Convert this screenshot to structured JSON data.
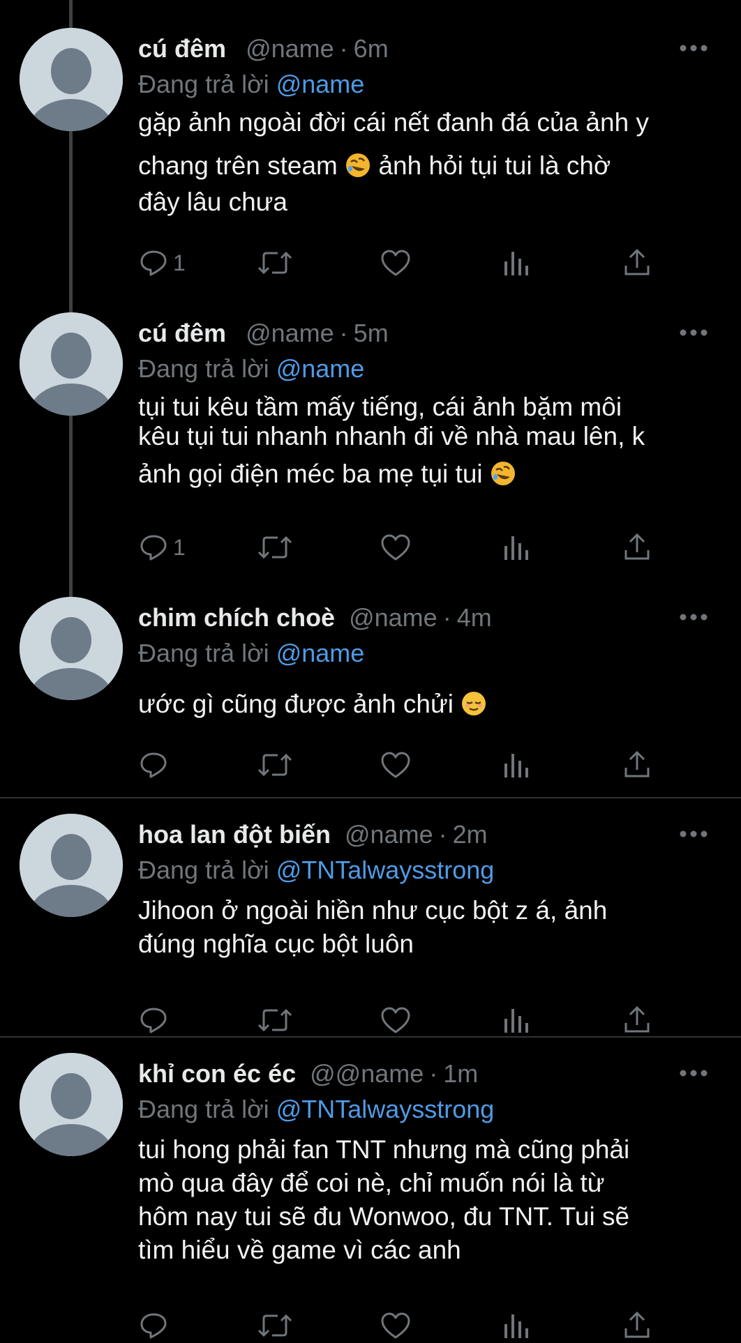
{
  "tweets": [
    {
      "name": "cú đêm",
      "handle": "@name",
      "time": "6m",
      "reply_label": "Đang trả lời",
      "reply_to": "@name",
      "lines": [
        "gặp ảnh ngoài đời cái nết đanh đá của ảnh y",
        "chang trên steam",
        "ảnh hỏi tụi tui là chờ",
        "đây lâu chưa"
      ],
      "reply_count": "1"
    },
    {
      "name": "cú đêm",
      "handle": "@name",
      "time": "5m",
      "reply_label": "Đang trả lời",
      "reply_to": "@name",
      "lines": [
        "tụi tui kêu tầm mấy tiếng, cái ảnh bặm môi",
        "kêu tụi tui nhanh nhanh đi về nhà mau lên, k",
        "ảnh gọi điện méc ba mẹ tụi tui"
      ],
      "reply_count": "1"
    },
    {
      "name": "chim chích choè",
      "handle": "@name",
      "time": "4m",
      "reply_label": "Đang trả lời",
      "reply_to": "@name",
      "lines": [
        "ước gì cũng được ảnh chửi"
      ],
      "reply_count": ""
    },
    {
      "name": "hoa lan đột biến",
      "handle": "@name",
      "time": "2m",
      "reply_label": "Đang trả lời",
      "reply_to": "@TNTalwaysstrong",
      "lines": [
        "Jihoon ở ngoài hiền như cục bột z á, ảnh",
        "đúng nghĩa cục bột luôn"
      ],
      "reply_count": ""
    },
    {
      "name": "khỉ con éc éc",
      "handle": "@@name",
      "time": "1m",
      "reply_label": "Đang trả lời",
      "reply_to": "@TNTalwaysstrong",
      "lines": [
        "tui hong phải fan TNT nhưng mà cũng phải",
        "mò qua đây để coi nè, chỉ muốn nói là từ",
        "hôm nay tui sẽ đu Wonwoo, đu TNT. Tui sẽ",
        "tìm hiểu về game vì các anh"
      ],
      "reply_count": ""
    }
  ],
  "icons": {
    "reply": "reply-icon",
    "retweet": "retweet-icon",
    "like": "heart-icon",
    "views": "views-icon",
    "share": "share-icon",
    "more": "more-icon",
    "laugh_emoji": "rolling-on-floor-laughing-emoji",
    "relieved_emoji": "relieved-face-emoji"
  },
  "colors": {
    "background": "#000000",
    "text": "#e7e9ea",
    "muted": "#71767b",
    "mention": "#4f9be6",
    "avatar": "#ccd6dd",
    "avatar_figure": "#6e7b88"
  }
}
